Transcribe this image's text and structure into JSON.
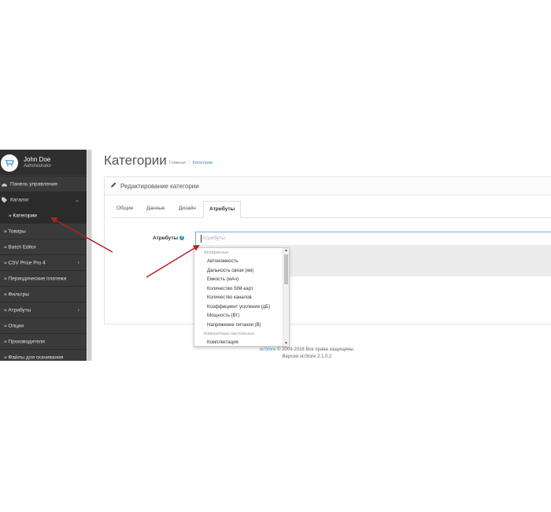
{
  "profile": {
    "name": "John Doe",
    "role": "Administrator"
  },
  "sidebar": {
    "items": [
      {
        "label": "Панель управления",
        "icon": "dashboard-icon",
        "chevron": ""
      },
      {
        "label": "Каталог",
        "icon": "tag-icon",
        "chevron": "⌄"
      },
      {
        "label": "» Категории",
        "icon": "",
        "chevron": ""
      },
      {
        "label": "» Товары",
        "icon": "",
        "chevron": ""
      },
      {
        "label": "» Batch Editor",
        "icon": "",
        "chevron": ""
      },
      {
        "label": "» CSV Price Pro 4",
        "icon": "",
        "chevron": "›"
      },
      {
        "label": "» Периодические платежи",
        "icon": "",
        "chevron": ""
      },
      {
        "label": "» Фильтры",
        "icon": "",
        "chevron": ""
      },
      {
        "label": "» Атрибуты",
        "icon": "",
        "chevron": "›"
      },
      {
        "label": "» Опции",
        "icon": "",
        "chevron": ""
      },
      {
        "label": "» Производители",
        "icon": "",
        "chevron": ""
      },
      {
        "label": "» Файлы для скачивания",
        "icon": "",
        "chevron": ""
      }
    ]
  },
  "header": {
    "title": "Категории",
    "breadcrumb": {
      "home": "Главная",
      "separator": "/",
      "current": "Категории"
    }
  },
  "panel": {
    "title": "Редактирование категории",
    "tabs": [
      "Общие",
      "Данные",
      "Дизайн",
      "Атрибуты"
    ],
    "field_label": "Атрибуты",
    "help": "?",
    "input_placeholder": "Атрибуты"
  },
  "dropdown": {
    "groups": [
      {
        "name": "Аппаратные",
        "items": [
          "Автономность",
          "Дальность связи (км)",
          "Емкость (мАч)",
          "Количество SIM-карт",
          "Количество каналов",
          "Коэффициент усиления (дБ)",
          "Мощность (Вт)",
          "Напряжение питания (В)"
        ]
      },
      {
        "name": "Компьютеры настольные",
        "items": [
          "Комплектация"
        ]
      }
    ]
  },
  "footer": {
    "brand": "ocStore",
    "copyright": " © 2009-2016 Все права защищены.",
    "version": "Версия ocStore 2.1.0.2"
  },
  "colors": {
    "accent": "#3b8dbd",
    "sidebar_bg": "#3a3a3a",
    "arrow": "#b22222"
  }
}
